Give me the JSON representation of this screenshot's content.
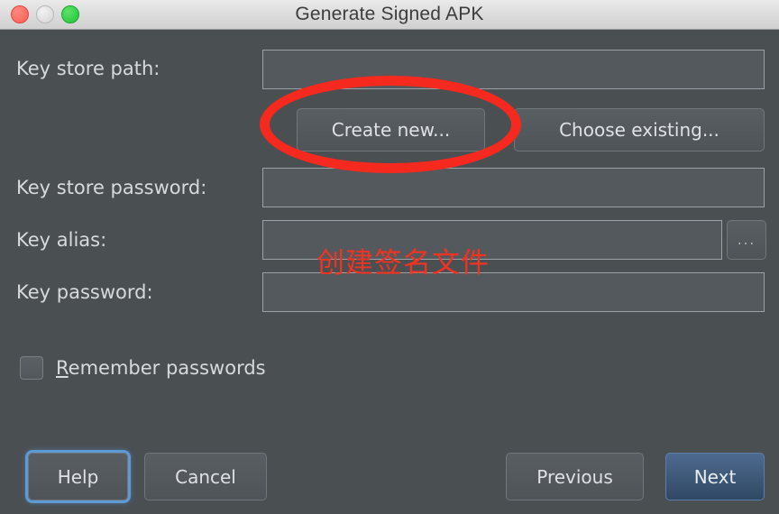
{
  "window": {
    "title": "Generate Signed APK",
    "traffic_lights": [
      {
        "name": "close-button",
        "color": "#fa5c52"
      },
      {
        "name": "minimize-button",
        "color": "#d4d4d4"
      },
      {
        "name": "zoom-button",
        "color": "#22c33a"
      }
    ]
  },
  "form": {
    "fields": [
      {
        "label": "Key store path:",
        "value": "",
        "placeholder": ""
      },
      {
        "label": "Key store password:",
        "value": "",
        "placeholder": ""
      },
      {
        "label": "Key alias:",
        "value": "",
        "placeholder": ""
      },
      {
        "label": "Key password:",
        "value": "",
        "placeholder": ""
      }
    ],
    "keystore_actions": {
      "create_new": "Create new...",
      "choose_existing": "Choose existing..."
    },
    "alias_browse": "...",
    "remember": {
      "mnemonic": "R",
      "rest": "emember passwords",
      "checked": false
    }
  },
  "footer": {
    "help": "Help",
    "cancel": "Cancel",
    "previous": "Previous",
    "next": "Next"
  },
  "annotations": {
    "highlight_target": "Create new...",
    "note_text": "创建签名文件",
    "color": "#f5291d"
  }
}
